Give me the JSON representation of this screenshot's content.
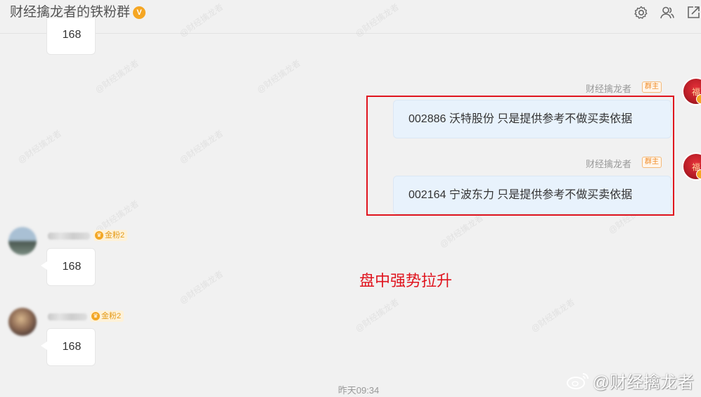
{
  "header": {
    "title": "财经擒龙者的铁粉群",
    "verified_badge": "V",
    "icons": [
      "settings-icon",
      "members-icon",
      "share-icon"
    ]
  },
  "messages": [
    {
      "type": "incoming",
      "text": "168",
      "partial": true
    },
    {
      "type": "outgoing",
      "sender": "财经擒龙者",
      "role_tag": "群主",
      "text": "002886 沃特股份  只是提供参考不做买卖依据"
    },
    {
      "type": "outgoing",
      "sender": "财经擒龙者",
      "role_tag": "群主",
      "text": "002164 宁波东力  只是提供参考不做买卖依据"
    },
    {
      "type": "incoming",
      "fan_tag": "金粉2",
      "text": "168"
    },
    {
      "type": "incoming",
      "fan_tag": "金粉2",
      "text": "168"
    }
  ],
  "annotation": "盘中强势拉升",
  "timestamp": "昨天09:34",
  "watermark": "@财经擒龙者",
  "owner_avatar_glyph": "福",
  "colors": {
    "background": "#f1f1f1",
    "outgoing_bubble": "#e8f2fc",
    "highlight": "#e0141e",
    "badge": "#f5a623"
  }
}
